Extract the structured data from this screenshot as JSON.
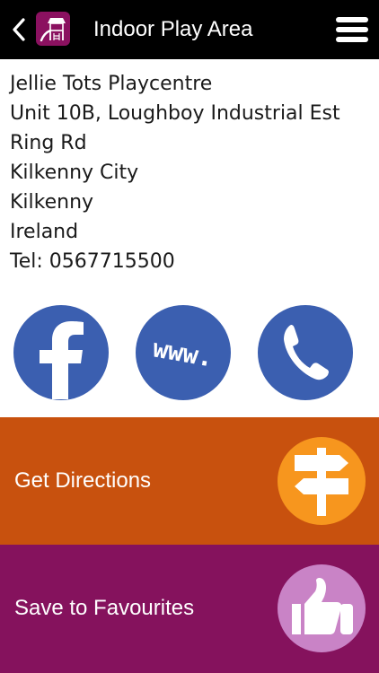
{
  "header": {
    "title": "Indoor Play Area",
    "icons": {
      "back": "chevron-left-icon",
      "app": "playhouse-icon",
      "menu": "hamburger-menu-icon"
    }
  },
  "address": {
    "lines": [
      "Jellie Tots Playcentre",
      "Unit 10B, Loughboy Industrial Est",
      "Ring Rd",
      "Kilkenny City",
      "Kilkenny",
      "Ireland",
      "Tel: 0567715500"
    ]
  },
  "social": {
    "www_text": "www.",
    "icons": {
      "facebook": "facebook-icon",
      "website": "www-icon",
      "phone": "phone-icon"
    }
  },
  "actions": {
    "directions_label": "Get Directions",
    "favourites_label": "Save to Favourites",
    "icons": {
      "directions": "signpost-icon",
      "favourites": "thumbs-up-icon"
    }
  },
  "colors": {
    "header_bg": "#000000",
    "app_icon_bg": "#8b1160",
    "social_blue": "#3b5fb0",
    "directions_bg": "#c8510e",
    "directions_circle": "#f7961e",
    "favourites_bg": "#85125d",
    "favourites_circle": "#c983c6"
  }
}
